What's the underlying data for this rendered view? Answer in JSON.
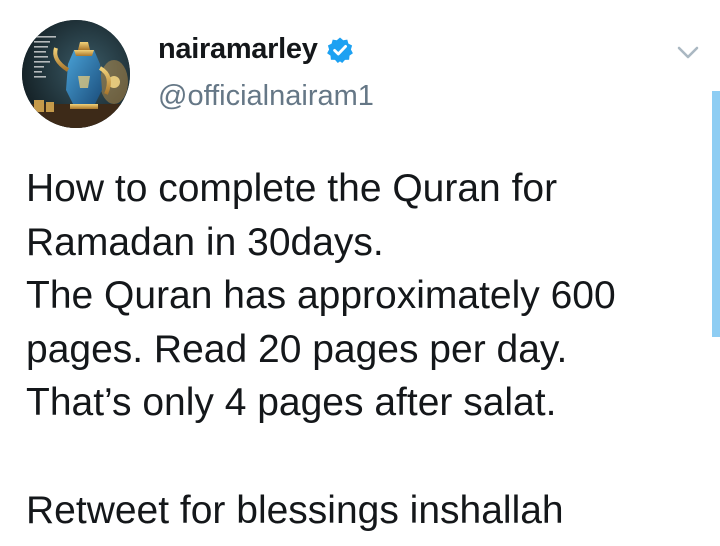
{
  "author": {
    "display_name": "nairamarley",
    "handle": "@officialnairam1",
    "verified": true,
    "verified_color": "#1da1f2"
  },
  "tweet": {
    "lines": [
      "How to complete the Quran for",
      "Ramadan in 30days.",
      "The Quran has approximately 600",
      "pages. Read 20 pages per day.",
      "That’s only 4 pages after salat.",
      "",
      "Retweet for blessings inshallah"
    ]
  },
  "icons": {
    "menu": "chevron-down-icon",
    "verified": "verified-badge-icon"
  },
  "colors": {
    "text": "#14171a",
    "secondary": "#657786",
    "accent": "#1da1f2"
  }
}
